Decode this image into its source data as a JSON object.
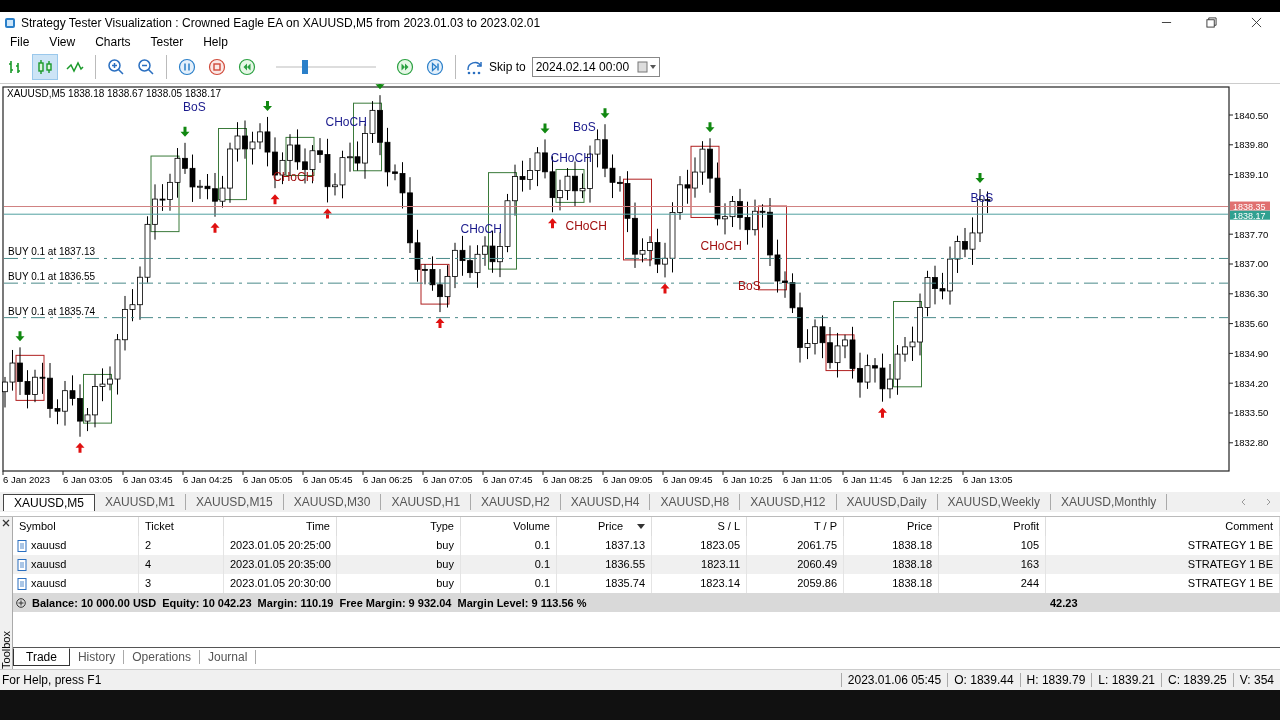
{
  "window": {
    "title": "Strategy Tester Visualization : Crowned Eagle EA on XAUUSD,M5 from 2023.01.03 to 2023.02.01"
  },
  "menu": [
    "File",
    "View",
    "Charts",
    "Tester",
    "Help"
  ],
  "toolbar": {
    "chart_types": [
      {
        "kind": "bars",
        "selected": false
      },
      {
        "kind": "candles",
        "selected": true
      },
      {
        "kind": "line",
        "selected": false
      }
    ],
    "speed": {
      "level": 0.29
    },
    "skip_button": "Skip to",
    "skip_date": "2024.02.14 00:00"
  },
  "chart": {
    "header": "XAUUSD,M5  1838.18 1838.67 1838.05 1838.17",
    "price_labels": [
      "1840.50",
      "1839.80",
      "1839.10",
      "1837.70",
      "1837.00",
      "1836.30",
      "1835.60",
      "1834.90",
      "1834.20",
      "1833.50",
      "1832.80"
    ],
    "time_labels": [
      "6 Jan 2023",
      "6 Jan 03:05",
      "6 Jan 03:45",
      "6 Jan 04:25",
      "6 Jan 05:05",
      "6 Jan 05:45",
      "6 Jan 06:25",
      "6 Jan 07:05",
      "6 Jan 07:45",
      "6 Jan 08:25",
      "6 Jan 09:05",
      "6 Jan 09:45",
      "6 Jan 10:25",
      "6 Jan 11:05",
      "6 Jan 11:45",
      "6 Jan 12:25",
      "6 Jan 13:05"
    ],
    "bid_tag": "1838.35",
    "ask_tag": "1838.17",
    "orders": [
      "BUY 0.1 at 1837.13",
      "BUY 0.1 at 1836.55",
      "BUY 0.1 at 1835.74"
    ],
    "signals": [
      {
        "text": "BoS",
        "color": "#1a1a8c"
      },
      {
        "text": "CHoCH",
        "color": "#1a1a8c"
      },
      {
        "text": "CHoCH",
        "color": "#a01010"
      },
      {
        "text": "BoS",
        "color": "#1a1a8c"
      },
      {
        "text": "CHoCH",
        "color": "#1a1a8c"
      },
      {
        "text": "CHoCH",
        "color": "#1a1a8c"
      },
      {
        "text": "CHoCH",
        "color": "#a01010"
      },
      {
        "text": "CHoCH",
        "color": "#a01010"
      },
      {
        "text": "BoS",
        "color": "#a01010"
      },
      {
        "text": "BoS",
        "color": "#1a1a8c"
      }
    ]
  },
  "chart_tabs": [
    {
      "label": "XAUUSD,M5",
      "selected": true
    },
    {
      "label": "XAUUSD,M1",
      "selected": false
    },
    {
      "label": "XAUUSD,M15",
      "selected": false
    },
    {
      "label": "XAUUSD,M30",
      "selected": false
    },
    {
      "label": "XAUUSD,H1",
      "selected": false
    },
    {
      "label": "XAUUSD,H2",
      "selected": false
    },
    {
      "label": "XAUUSD,H4",
      "selected": false
    },
    {
      "label": "XAUUSD,H8",
      "selected": false
    },
    {
      "label": "XAUUSD,H12",
      "selected": false
    },
    {
      "label": "XAUUSD,Daily",
      "selected": false
    },
    {
      "label": "XAUUSD,Weekly",
      "selected": false
    },
    {
      "label": "XAUUSD,Monthly",
      "selected": false
    }
  ],
  "trade_table": {
    "columns": [
      {
        "label": "Symbol",
        "sorted": false
      },
      {
        "label": "Ticket",
        "sorted": false
      },
      {
        "label": "Time",
        "sorted": false
      },
      {
        "label": "Type",
        "sorted": false
      },
      {
        "label": "Volume",
        "sorted": false
      },
      {
        "label": "Price",
        "sorted": true
      },
      {
        "label": "S / L",
        "sorted": false
      },
      {
        "label": "T / P",
        "sorted": false
      },
      {
        "label": "Price",
        "sorted": false
      },
      {
        "label": "Profit",
        "sorted": false
      },
      {
        "label": "Comment",
        "sorted": false
      }
    ],
    "rows": [
      [
        "xauusd",
        "2",
        "2023.01.05 20:25:00",
        "buy",
        "0.1",
        "1837.13",
        "1823.05",
        "2061.75",
        "1838.18",
        "105",
        "STRATEGY 1 BE"
      ],
      [
        "xauusd",
        "4",
        "2023.01.05 20:35:00",
        "buy",
        "0.1",
        "1836.55",
        "1823.11",
        "2060.49",
        "1838.18",
        "163",
        "STRATEGY 1 BE"
      ],
      [
        "xauusd",
        "3",
        "2023.01.05 20:30:00",
        "buy",
        "0.1",
        "1835.74",
        "1823.14",
        "2059.86",
        "1838.18",
        "244",
        "STRATEGY 1 BE"
      ]
    ],
    "summary": {
      "text": "Balance: 10 000.00 USD  Equity: 10 042.23  Margin: 110.19  Free Margin: 9 932.04  Margin Level: 9 113.56 %",
      "profit": "42.23"
    }
  },
  "toolbox_label": "Toolbox",
  "panel_tabs": [
    {
      "label": "Trade",
      "selected": true
    },
    {
      "label": "History",
      "selected": false
    },
    {
      "label": "Operations",
      "selected": false
    },
    {
      "label": "Journal",
      "selected": false
    }
  ],
  "status_bar": {
    "help": "For Help, press F1",
    "cells": [
      "2023.01.06 05:45",
      "O: 1839.44",
      "H: 1839.79",
      "L: 1839.21",
      "C: 1839.25",
      "V: 354"
    ]
  }
}
